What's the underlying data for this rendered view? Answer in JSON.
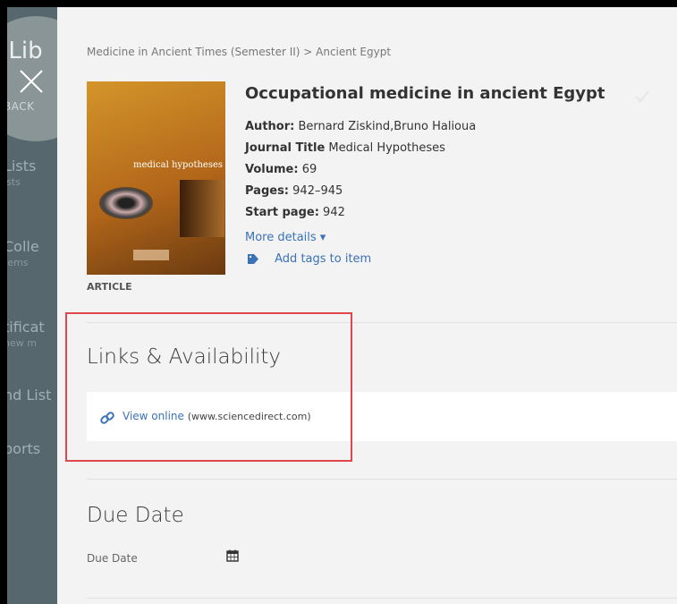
{
  "sidebar": {
    "logo_text": "xLib",
    "back_label": "BACK",
    "items": [
      {
        "label": "Lists",
        "sub": "ists"
      },
      {
        "label": "Colle",
        "sub": "tems"
      },
      {
        "label": "tificat",
        "sub": "new m"
      },
      {
        "label": "nd List",
        "sub": ""
      },
      {
        "label": "ports",
        "sub": ""
      }
    ]
  },
  "breadcrumb": "Medicine in Ancient Times (Semester II) > Ancient Egypt",
  "cover": {
    "title_text": "medical hypotheses"
  },
  "item": {
    "type": "ARTICLE",
    "title": "Occupational medicine in ancient Egypt",
    "author_label": "Author:",
    "author": "Bernard Ziskind,Bruno Halioua",
    "journal_label": "Journal Title",
    "journal": "Medical Hypotheses",
    "volume_label": "Volume:",
    "volume": "69",
    "pages_label": "Pages:",
    "pages": "942–945",
    "start_label": "Start page:",
    "start": "942",
    "more_details": "More details ▾",
    "add_tags": "Add tags to item"
  },
  "links": {
    "heading": "Links & Availability",
    "view_online": "View online",
    "domain": "(www.sciencedirect.com)"
  },
  "due": {
    "heading": "Due Date",
    "label": "Due Date"
  },
  "colors": {
    "sidebar": "#56676d",
    "link": "#3a72b8",
    "highlight": "#e0474c"
  }
}
